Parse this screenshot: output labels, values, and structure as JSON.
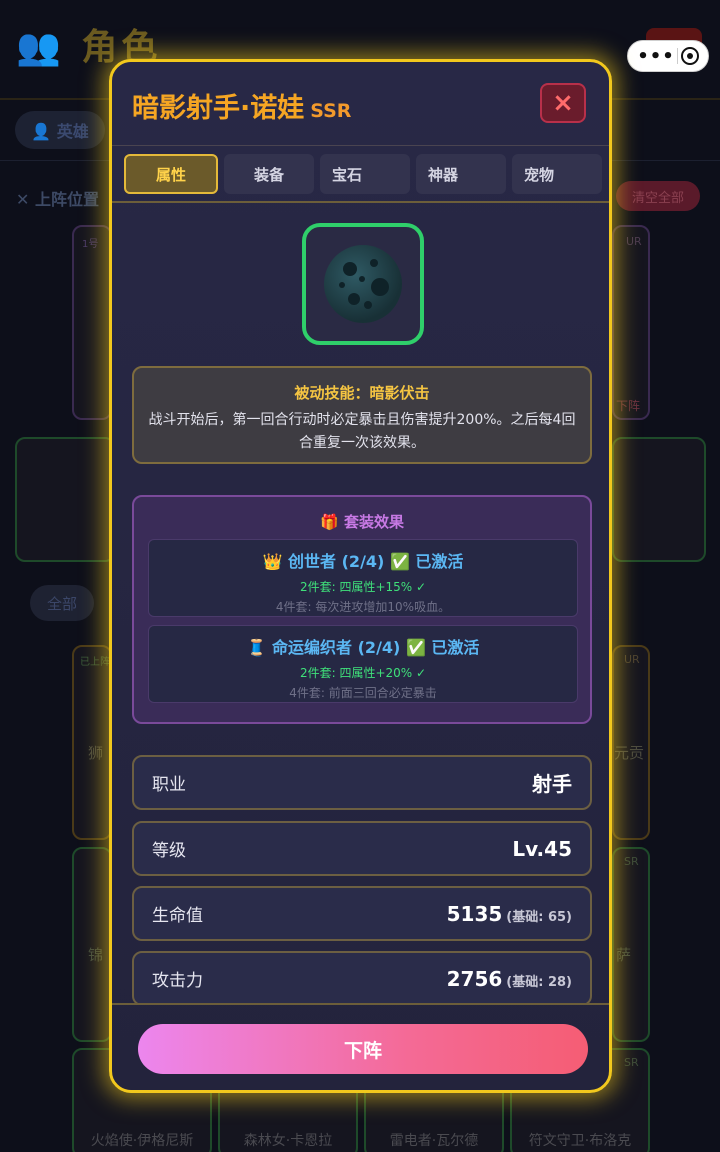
{
  "background": {
    "title": "👥 角色",
    "tab_heroes": "👤 英雄",
    "position_label": "✕ 上阵位置",
    "clear_all": "清空全部",
    "filter_all": "全部",
    "slot_badge": "1号",
    "slot_badge_2": "已上阵",
    "card_rarities": [
      "UR",
      "UR",
      "SR",
      "SR"
    ],
    "card_action": "下阵",
    "card_names": [
      "火焰使·伊格尼斯",
      "森林女·卡恩拉",
      "雷电者·瓦尔德",
      "符文守卫·布洛克"
    ],
    "card_name_fragments": [
      "狮",
      "元贡",
      "锦",
      "萨"
    ]
  },
  "modal": {
    "title": "暗影射手·诺娃",
    "rarity": "SSR",
    "close_icon": "×",
    "tabs": [
      "属性",
      "装备",
      "宝石",
      "神器",
      "宠物"
    ],
    "active_tab": "属性",
    "skill": {
      "title": "被动技能：暗影伏击",
      "desc": "战斗开始后，第一回合行动时必定暴击且伤害提升200%。之后每4回合重复一次该效果。"
    },
    "set_effects": {
      "title": "🎁 套装效果",
      "sets": [
        {
          "icon": "👑",
          "name": "创世者 (2/4)",
          "status": "✅ 已激活",
          "bonus2": "2件套: 四属性+15% ✓",
          "bonus4": "4件套: 每次进攻增加10%吸血。"
        },
        {
          "icon": "🧵",
          "name": "命运编织者 (2/4)",
          "status": "✅ 已激活",
          "bonus2": "2件套: 四属性+20% ✓",
          "bonus4": "4件套: 前面三回合必定暴击"
        }
      ]
    },
    "stats": [
      {
        "label": "职业",
        "value": "射手",
        "base": ""
      },
      {
        "label": "等级",
        "value": "Lv.45",
        "base": ""
      },
      {
        "label": "生命值",
        "value": "5135",
        "base": "(基础: 65)"
      },
      {
        "label": "攻击力",
        "value": "2756",
        "base": "(基础: 28)"
      }
    ],
    "action_button": "下阵"
  },
  "colors": {
    "modal_border": "#f2c81d",
    "title": "#f6a623",
    "portrait_border": "#2fcf6a",
    "set_name": "#5bb7f3",
    "bonus_active": "#3fe07a",
    "button_gradient_start": "#ec86ee",
    "button_gradient_end": "#f55d74"
  },
  "icons": {
    "close": "close-icon",
    "portrait": "dark-moon-icon",
    "gift": "gift-icon",
    "crown": "crown-icon",
    "thread": "thread-spool-icon",
    "check": "checkmark-icon",
    "capsule_menu": "more-dots-icon",
    "capsule_close": "mini-program-close-icon"
  }
}
